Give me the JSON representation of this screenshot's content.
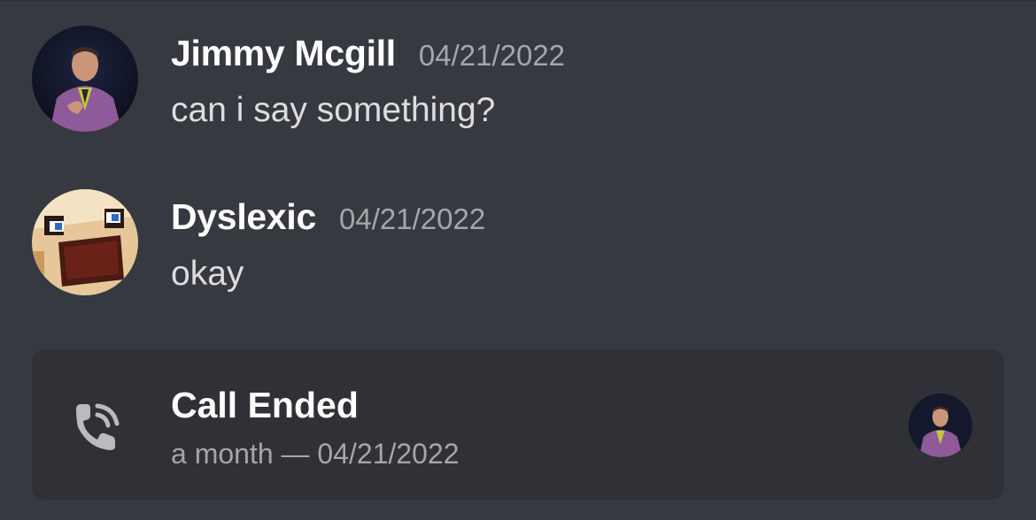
{
  "messages": [
    {
      "username": "Jimmy Mcgill",
      "timestamp": "04/21/2022",
      "content": "can i say something?",
      "avatar_icon": "man-in-purple-suit-avatar"
    },
    {
      "username": "Dyslexic",
      "timestamp": "04/21/2022",
      "content": "okay",
      "avatar_icon": "blocky-cartoon-face-avatar"
    }
  ],
  "call": {
    "title": "Call Ended",
    "subtitle": "a month — 04/21/2022",
    "icon": "phone-call-icon",
    "participant_icon": "man-in-purple-suit-avatar"
  },
  "colors": {
    "background": "#36393f",
    "card": "#2f3136",
    "username": "#ffffff",
    "timestamp": "#a3a6aa",
    "message_text": "#dcddde"
  }
}
